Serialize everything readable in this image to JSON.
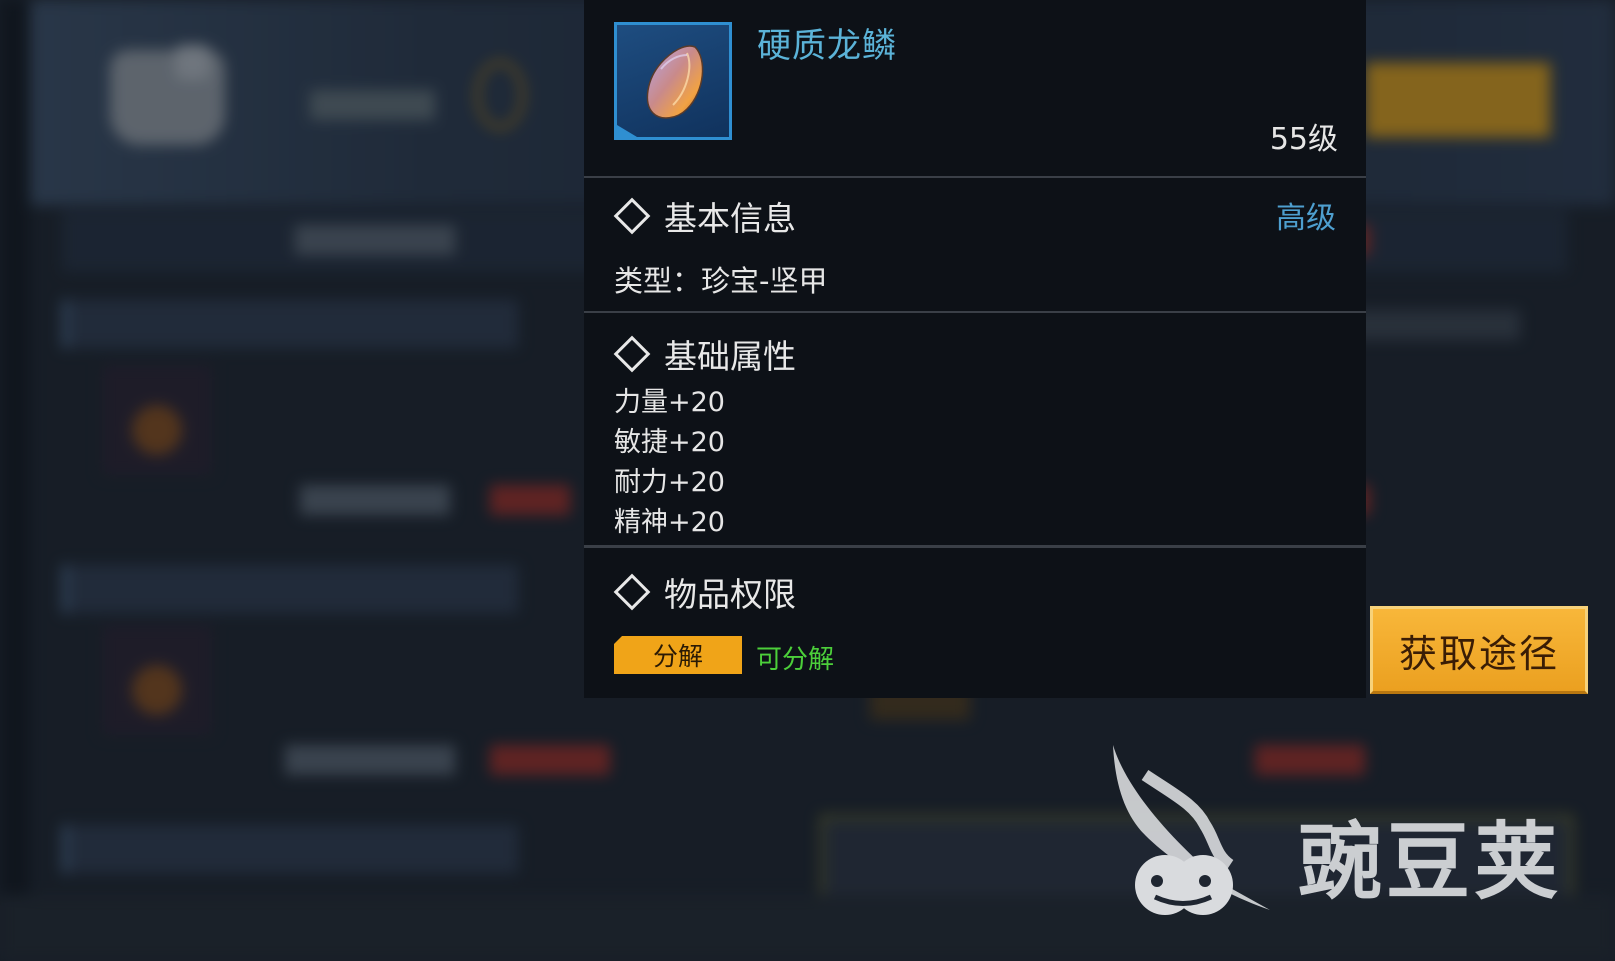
{
  "item": {
    "name": "硬质龙鳞",
    "level": "55级",
    "icon": "dragon-scale-gem-icon"
  },
  "basic_info": {
    "title": "基本信息",
    "grade": "高级",
    "type_line": "类型：珍宝-坚甲"
  },
  "base_attributes": {
    "title": "基础属性",
    "items": [
      "力量+20",
      "敏捷+20",
      "耐力+20",
      "精神+20"
    ]
  },
  "permissions": {
    "title": "物品权限",
    "tag_label": "分解",
    "tag_status": "可分解"
  },
  "acquire_button": "获取途径",
  "watermark": "豌豆荚",
  "colors": {
    "item_name": "#5bb3d8",
    "grade": "#4e9fcf",
    "tag_bg": "#f0a418",
    "status_green": "#4ccf3a",
    "button": "#eba020"
  }
}
